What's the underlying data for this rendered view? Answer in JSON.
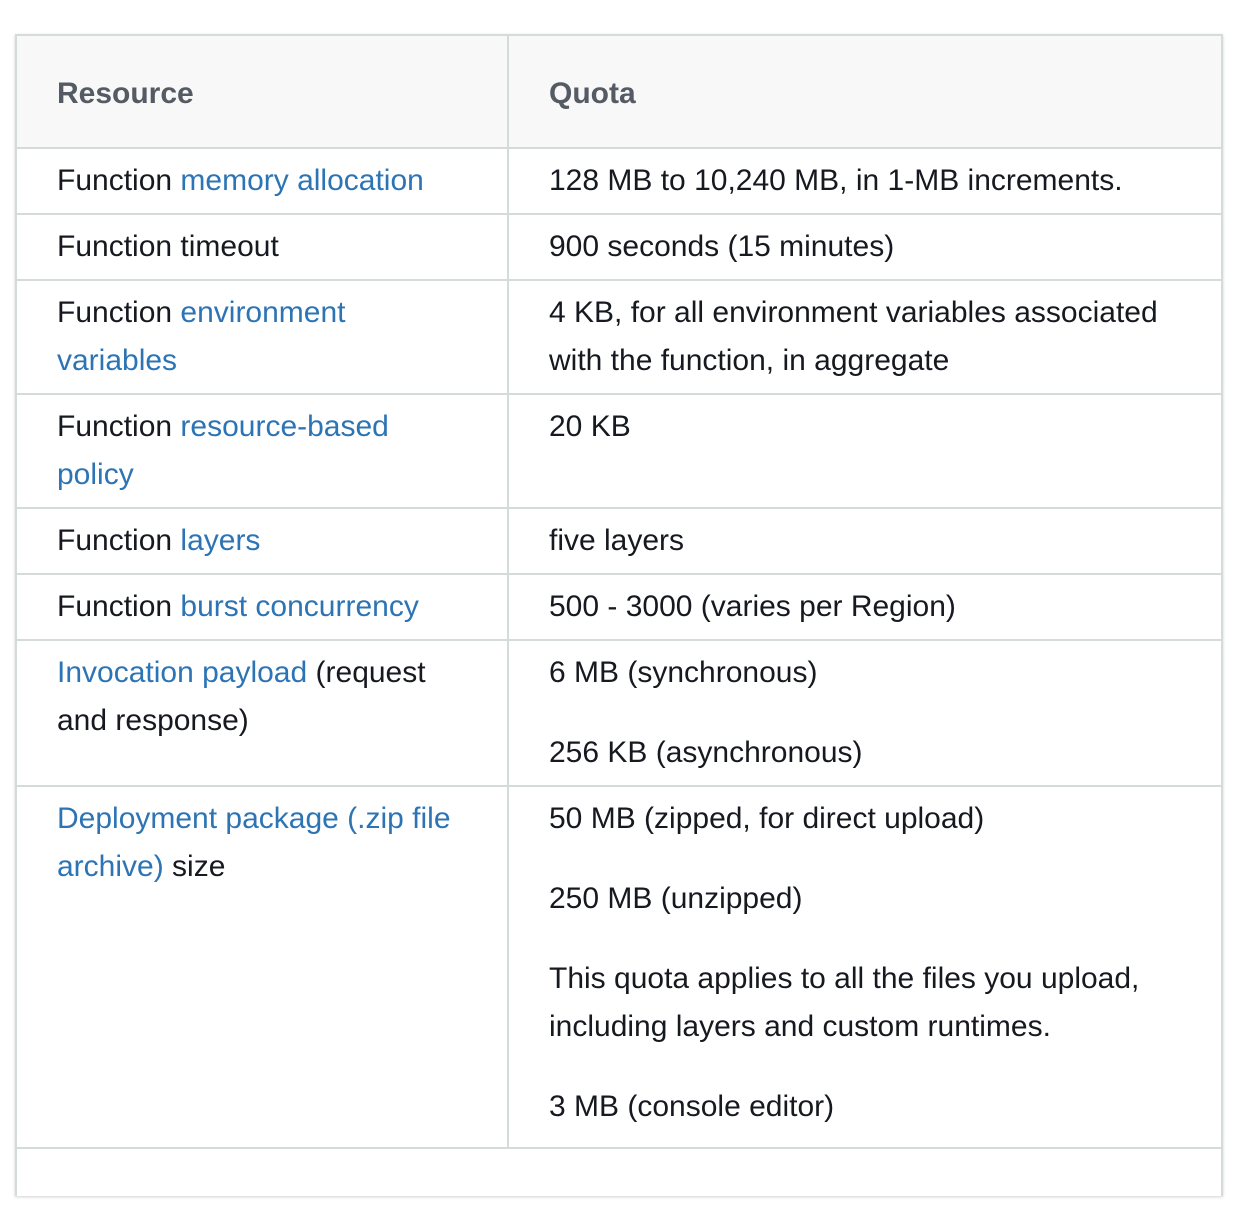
{
  "table": {
    "headers": {
      "resource": "Resource",
      "quota": "Quota"
    },
    "rows": [
      {
        "resource": [
          {
            "text": "Function ",
            "link": false
          },
          {
            "text": "memory allocation",
            "link": true
          }
        ],
        "quota": [
          "128 MB to 10,240 MB, in 1-MB increments."
        ]
      },
      {
        "resource": [
          {
            "text": "Function timeout",
            "link": false
          }
        ],
        "quota": [
          "900 seconds (15 minutes)"
        ]
      },
      {
        "resource": [
          {
            "text": "Function ",
            "link": false
          },
          {
            "text": "environment variables",
            "link": true
          }
        ],
        "quota": [
          "4 KB, for all environment variables associated with the function, in aggregate"
        ]
      },
      {
        "resource": [
          {
            "text": "Function ",
            "link": false
          },
          {
            "text": "resource-based policy",
            "link": true
          }
        ],
        "quota": [
          "20 KB"
        ]
      },
      {
        "resource": [
          {
            "text": "Function ",
            "link": false
          },
          {
            "text": "layers",
            "link": true
          }
        ],
        "quota": [
          "five layers"
        ]
      },
      {
        "resource": [
          {
            "text": "Function ",
            "link": false
          },
          {
            "text": "burst concurrency",
            "link": true
          }
        ],
        "quota": [
          "500 - 3000 (varies per Region)"
        ]
      },
      {
        "resource": [
          {
            "text": "Invocation payload",
            "link": true
          },
          {
            "text": " (request and response)",
            "link": false
          }
        ],
        "quota": [
          "6 MB (synchronous)",
          "256 KB (asynchronous)"
        ]
      },
      {
        "resource": [
          {
            "text": "Deployment package (.zip file archive)",
            "link": true
          },
          {
            "text": " size",
            "link": false
          }
        ],
        "quota": [
          "50 MB (zipped, for direct upload)",
          "250 MB (unzipped)",
          "This quota applies to all the files you upload, including layers and custom runtimes.",
          "3 MB (console editor)"
        ]
      }
    ]
  },
  "colors": {
    "link": "#2d74b5",
    "text": "#16191f",
    "header_text": "#545b64",
    "header_bg": "#f8f8f8",
    "border": "#d5dbdb"
  }
}
